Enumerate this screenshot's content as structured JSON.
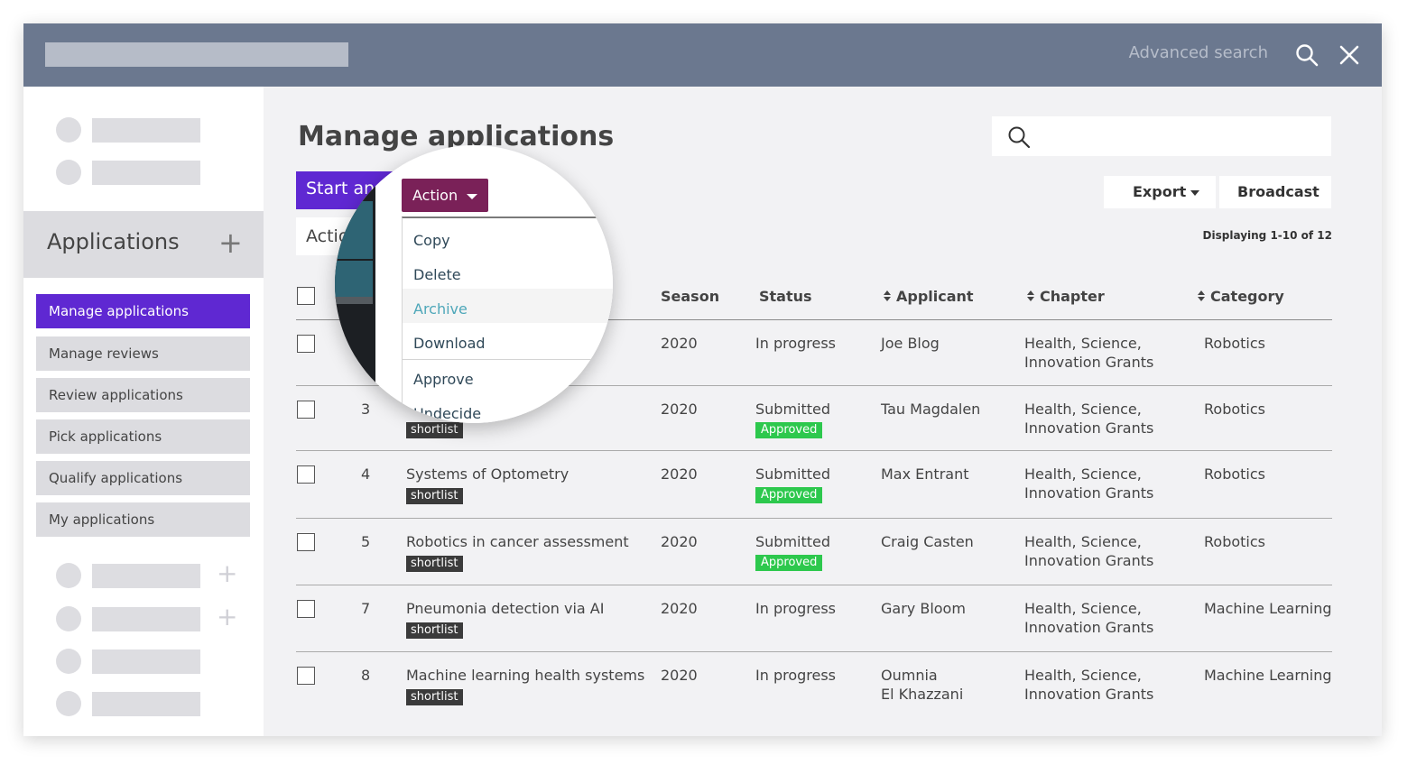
{
  "topbar": {
    "advanced_search": "Advanced search"
  },
  "sidebar": {
    "applications_label": "Applications",
    "nav": [
      {
        "label": "Manage applications"
      },
      {
        "label": "Manage reviews"
      },
      {
        "label": "Review applications"
      },
      {
        "label": "Pick applications"
      },
      {
        "label": "Qualify applications"
      },
      {
        "label": "My applications"
      }
    ]
  },
  "main": {
    "title": "Manage applications",
    "search_placeholder": "",
    "start_button": "Start an",
    "action_bar": "Actio",
    "export": "Export",
    "broadcast": "Broadcast",
    "displaying": "Displaying 1-10 of 12"
  },
  "table": {
    "headers": {
      "season": "Season",
      "status": "Status",
      "applicant": "Applicant",
      "chapter": "Chapter",
      "category": "Category"
    },
    "rows": [
      {
        "id": "",
        "title": "",
        "tag": "",
        "season": "2020",
        "status": "In progress",
        "approved": "",
        "applicant": "Joe Blog",
        "applicant2": "",
        "chapter1": "Health, Science,",
        "chapter2": "Innovation Grants",
        "category": "Robotics"
      },
      {
        "id": "3",
        "title": "",
        "tag": "shortlist",
        "season": "2020",
        "status": "Submitted",
        "approved": "Approved",
        "applicant": "Tau Magdalen",
        "applicant2": "",
        "chapter1": "Health, Science,",
        "chapter2": "Innovation Grants",
        "category": "Robotics"
      },
      {
        "id": "4",
        "title": "Systems of Optometry",
        "tag": "shortlist",
        "season": "2020",
        "status": "Submitted",
        "approved": "Approved",
        "applicant": "Max Entrant",
        "applicant2": "",
        "chapter1": "Health, Science,",
        "chapter2": "Innovation Grants",
        "category": "Robotics"
      },
      {
        "id": "5",
        "title": "Robotics in cancer assessment",
        "tag": "shortlist",
        "season": "2020",
        "status": "Submitted",
        "approved": "Approved",
        "applicant": "Craig Casten",
        "applicant2": "",
        "chapter1": "Health, Science,",
        "chapter2": "Innovation Grants",
        "category": "Robotics"
      },
      {
        "id": "7",
        "title": "Pneumonia detection via AI",
        "tag": "shortlist",
        "season": "2020",
        "status": "In progress",
        "approved": "",
        "applicant": "Gary Bloom",
        "applicant2": "",
        "chapter1": "Health, Science,",
        "chapter2": "Innovation Grants",
        "category": "Machine Learning"
      },
      {
        "id": "8",
        "title": "Machine learning health systems",
        "tag": "shortlist",
        "season": "2020",
        "status": "In progress",
        "approved": "",
        "applicant": "Oumnia",
        "applicant2": "El Khazzani",
        "chapter1": "Health, Science,",
        "chapter2": "Innovation Grants",
        "category": "Machine Learning"
      }
    ]
  },
  "magnifier": {
    "action_label": "Action",
    "menu": [
      "Copy",
      "Delete",
      "Archive",
      "Download",
      "Approve",
      "Undecide"
    ]
  },
  "colors": {
    "topbar": "#6b788f",
    "primary": "#5f28d2",
    "action_button": "#7a2158",
    "approved": "#2dc84d",
    "shortlist": "#3b3b3b"
  }
}
